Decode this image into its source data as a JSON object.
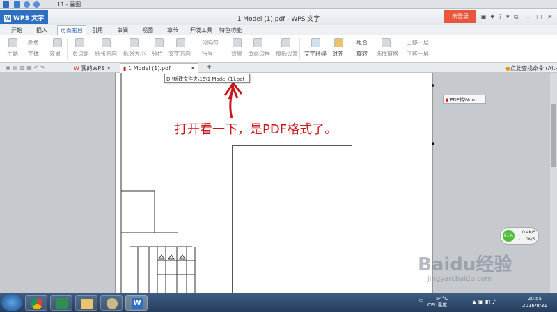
{
  "quick_access": {
    "title": "11 - 画图"
  },
  "titlebar": {
    "app_button": "WPS 文字",
    "window_title": "1 Model (1).pdf - WPS 文字",
    "login_button": "未登录",
    "help": "?"
  },
  "menu": {
    "tabs": [
      {
        "label": "开始"
      },
      {
        "label": "插入"
      },
      {
        "label": "页面布局"
      },
      {
        "label": "引用"
      },
      {
        "label": "审阅"
      },
      {
        "label": "视图"
      },
      {
        "label": "章节"
      },
      {
        "label": "开发工具"
      },
      {
        "label": "特色功能"
      }
    ]
  },
  "ribbon": {
    "theme": "主题",
    "color": "颜色",
    "font": "字体",
    "effect": "效果",
    "margins": "页边距",
    "orientation": "纸张方向",
    "size": "纸张大小",
    "columns": "分栏",
    "text_direction": "文字方向",
    "breaks": "分隔符",
    "line_numbers": "行号",
    "background": "背景",
    "page_border": "页面边框",
    "draft": "稿纸设置",
    "wrap": "文字环绕",
    "align": "对齐",
    "group": "组合",
    "rotate": "旋转",
    "select_pane": "选择窗格",
    "bring_forward": "上移一层",
    "send_backward": "下移一层"
  },
  "doc_tabs": {
    "my_wps": "我的WPS",
    "active_doc": "1 Model (1).pdf",
    "add": "+",
    "search_command": "点此查找命令 (Alt+Q)"
  },
  "document": {
    "tooltip_path": "D:\\新建文件夹\\15\\1 Model (1).pdf",
    "pdf_to_word": "PDF转Word",
    "annotation": "打开看一下，是PDF格式了。"
  },
  "network": {
    "percent": "61%",
    "up": "0.4K/S",
    "down": "0K/S"
  },
  "taskbar": {
    "temp": "54°C",
    "cpu": "CPU温度",
    "time": "20:55",
    "date": "2016/8/31"
  },
  "watermark": {
    "brand": "Baidu经验",
    "url": "jingyan.baidu.com"
  },
  "colors": {
    "accent": "#2f6fc1",
    "login": "#e8563c",
    "annotation": "#c8161d"
  }
}
